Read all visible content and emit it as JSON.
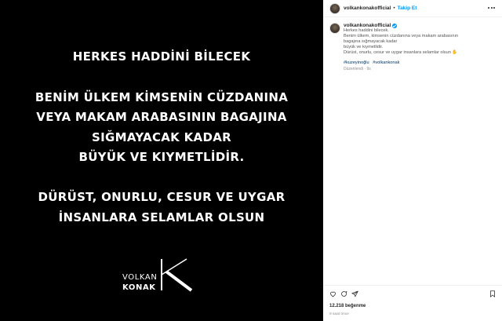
{
  "post_image": {
    "lines": [
      "HERKES HADDİNİ BİLECEK",
      "BENİM ÜLKEM KİMSENİN CÜZDANINA",
      "VEYA MAKAM ARABASININ BAGAJINA",
      "SIĞMAYACAK KADAR",
      "BÜYÜK VE KIYMETLİDİR.",
      "DÜRÜST, ONURLU, CESUR VE UYGAR",
      "İNSANLARA SELAMLAR OLSUN"
    ],
    "logo": {
      "line1": "VOLKAN",
      "line2": "KONAK"
    }
  },
  "header": {
    "username": "volkankonakofficial",
    "separator": "•",
    "follow_label": "Takip Et",
    "more_icon": "ellipsis-icon"
  },
  "caption": {
    "username": "volkankonakofficial",
    "lines": [
      "Herkes haddini bilecek.",
      "Benim ülkem, kimsenin cüzdanına veya makam arabasının",
      "bagajına sığmayacak kadar",
      "büyük ve kıymetlidir.",
      "Dürüst, onurlu, cesur ve uygar insanlara selamlar olsun ✋"
    ],
    "hashtags": [
      "#kuzeyinoğlu",
      "#volkankonak"
    ],
    "meta": "Düzenlendi · 9s"
  },
  "actions": {
    "icons": [
      "heart-icon",
      "comment-icon",
      "share-icon",
      "bookmark-icon"
    ],
    "likes": "12.218 beğenme",
    "time_ago": "9 saat önce"
  },
  "colors": {
    "accent": "#0095f6",
    "hashtag": "#00376b",
    "muted": "#8e8e8e",
    "text": "#262626"
  }
}
